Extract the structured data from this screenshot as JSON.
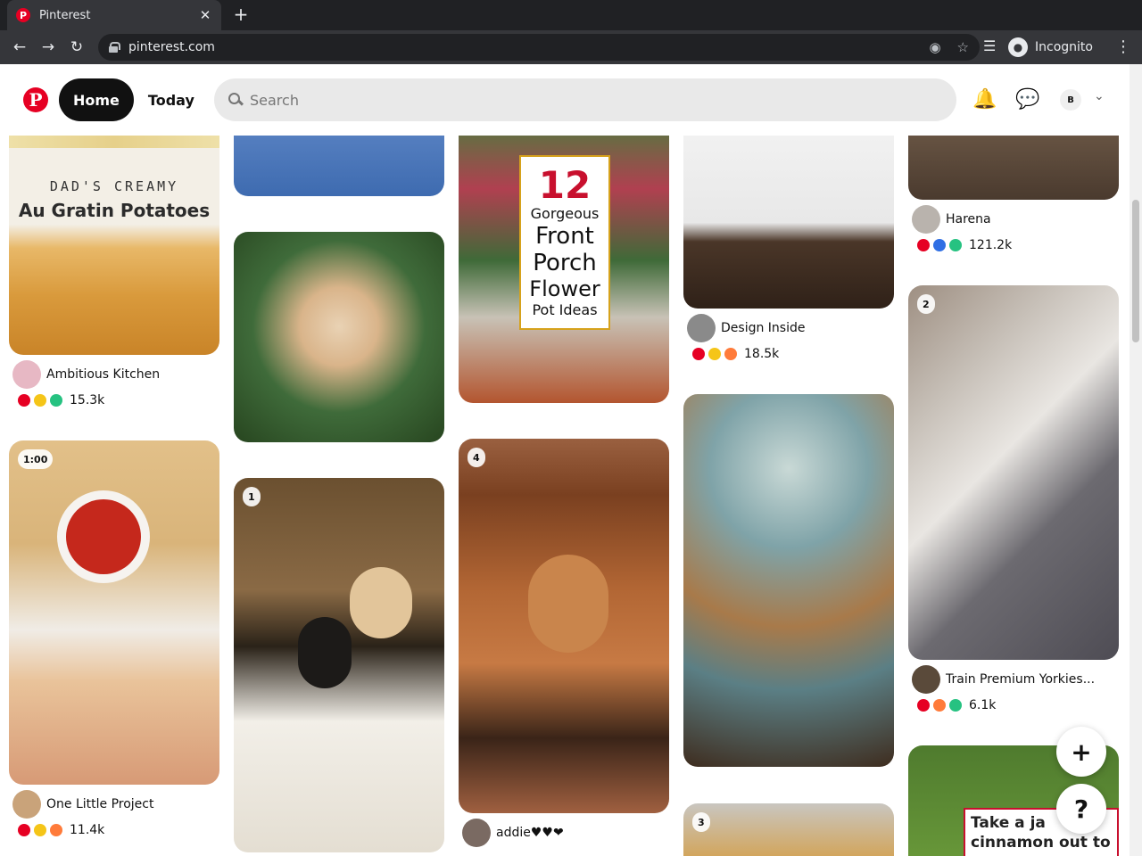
{
  "browser": {
    "tab_title": "Pinterest",
    "tab_close": "✕",
    "new_tab": "+",
    "url": "pinterest.com",
    "profile_label": "Incognito"
  },
  "header": {
    "home_label": "Home",
    "today_label": "Today",
    "search_placeholder": "Search",
    "user_initial": "B"
  },
  "pins": [
    {
      "creator": "Ambitious Kitchen",
      "count": "15.3k",
      "text_top": "DAD'S CREAMY",
      "text_main": "Au Gratin Potatoes"
    },
    {
      "badge": "1:00",
      "creator": "One Little Project",
      "count": "11.4k"
    },
    {
      "badge": "1"
    },
    {
      "title_num": "12",
      "title_lines": [
        "Gorgeous",
        "Front",
        "Porch",
        "Flower",
        "Pot Ideas"
      ]
    },
    {
      "badge": "4",
      "creator": "addie♥♥❤"
    },
    {
      "creator": "Design Inside",
      "count": "18.5k"
    },
    {
      "badge": "3"
    },
    {
      "creator": "Harena",
      "count": "121.2k"
    },
    {
      "badge": "2",
      "creator": "Train Premium Yorkies...",
      "count": "6.1k"
    },
    {
      "text_lines": [
        "Take a ja",
        "cinnamon out to"
      ]
    }
  ],
  "fab": {
    "plus": "+",
    "help": "?"
  },
  "colors": {
    "brand": "#e60023",
    "home_bg": "#111111",
    "search_bg": "#e9e9e9"
  }
}
